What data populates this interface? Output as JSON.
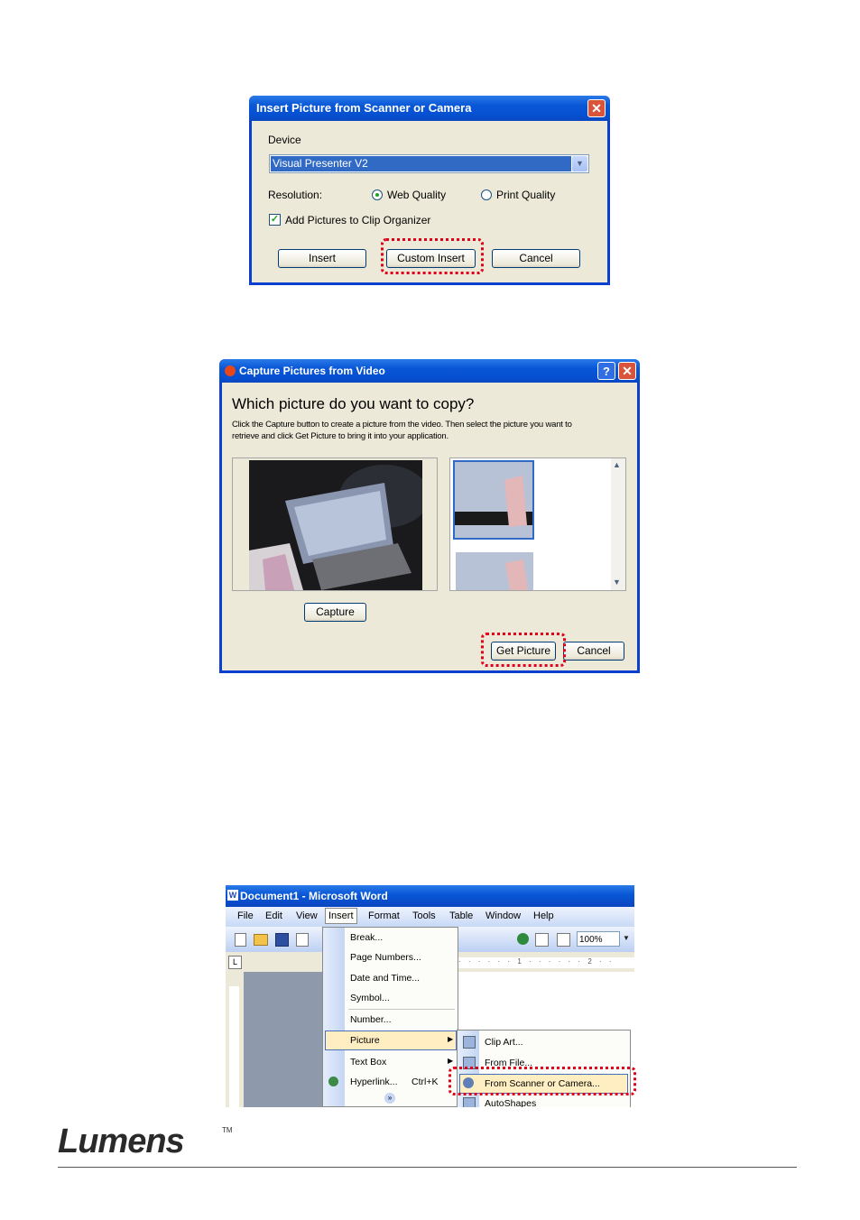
{
  "dialog1": {
    "title": "Insert Picture from Scanner or Camera",
    "device_label": "Device",
    "device_value": "Visual Presenter V2",
    "resolution_label": "Resolution:",
    "web_quality": "Web Quality",
    "print_quality": "Print Quality",
    "resolution_selected": "Web Quality",
    "add_to_organizer": "Add Pictures to Clip Organizer",
    "add_to_organizer_checked": true,
    "insert_button": "Insert",
    "custom_insert_button": "Custom Insert",
    "cancel_button": "Cancel"
  },
  "dialog2": {
    "title": "Capture Pictures from Video",
    "heading": "Which picture do you want to copy?",
    "instruction_line1": "Click the Capture button to create a picture from the video.  Then select the picture you want to",
    "instruction_line2": "retrieve and click Get Picture to bring it into your application.",
    "capture_button": "Capture",
    "get_picture_button": "Get Picture",
    "cancel_button": "Cancel"
  },
  "word": {
    "title": "Document1 - Microsoft Word",
    "menus": [
      "File",
      "Edit",
      "View",
      "Insert",
      "Format",
      "Tools",
      "Table",
      "Window",
      "Help"
    ],
    "zoom": "100%",
    "insert_menu_items": [
      "Break...",
      "Page Numbers...",
      "Date and Time...",
      "Symbol...",
      "Number...",
      "Picture",
      "Text Box",
      "Hyperlink..."
    ],
    "hyperlink_shortcut": "Ctrl+K",
    "picture_submenu_items": [
      "Clip Art...",
      "From File...",
      "From Scanner or Camera...",
      "AutoShapes"
    ]
  },
  "footer": {
    "logo": "Lumens",
    "trademark": "TM"
  },
  "colors": {
    "highlight_dash": "#e0001a",
    "xp_title_blue": "#0856d6"
  }
}
